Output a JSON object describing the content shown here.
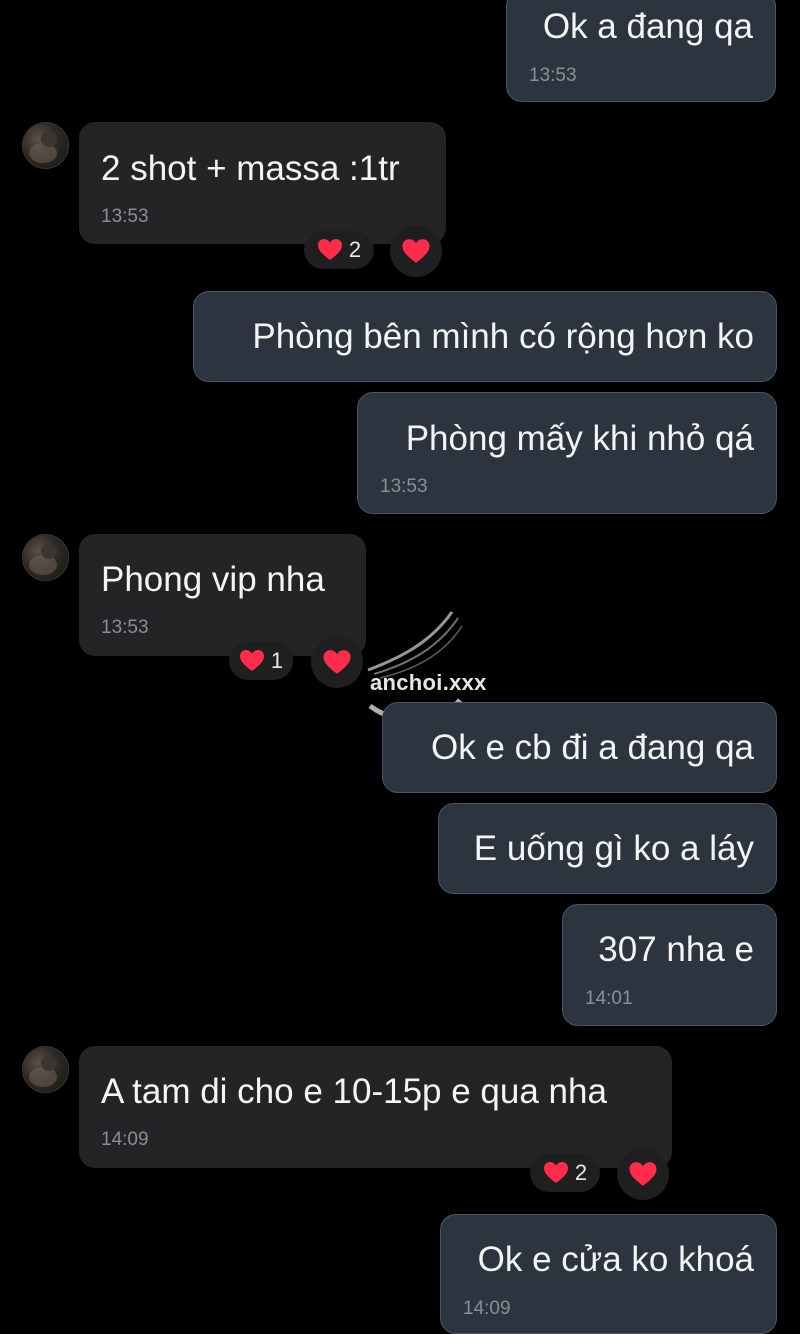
{
  "messages": [
    {
      "side": "out",
      "text": "Ok a đang qa",
      "time": "13:53"
    },
    {
      "side": "in",
      "text": "2 shot + massa :1tr",
      "time": "13:53",
      "reaction_count": "2"
    },
    {
      "side": "out",
      "text": "Phòng bên mình có rộng hơn ko",
      "time": ""
    },
    {
      "side": "out",
      "text": "Phòng mấy khi nhỏ qá",
      "time": "13:53"
    },
    {
      "side": "in",
      "text": "Phong vip nha",
      "time": "13:53",
      "reaction_count": "1"
    },
    {
      "side": "out",
      "text": "Ok e cb đi a đang qa",
      "time": ""
    },
    {
      "side": "out",
      "text": "E uống gì ko a láy",
      "time": ""
    },
    {
      "side": "out",
      "text": "307 nha e",
      "time": "14:01"
    },
    {
      "side": "in",
      "text": "A tam di cho e 10-15p e qua nha",
      "time": "14:09",
      "reaction_count": "2"
    },
    {
      "side": "out",
      "text": "Ok e cửa ko khoá",
      "time": "14:09"
    }
  ],
  "watermark": {
    "text": "anchoi.xxx"
  },
  "icons": {
    "reaction": "heart-icon",
    "avatar": "contact-avatar"
  },
  "colors": {
    "background": "#000000",
    "outgoing_bubble": "#2c3440",
    "incoming_bubble": "#242426",
    "heart": "#ff2d4b"
  }
}
